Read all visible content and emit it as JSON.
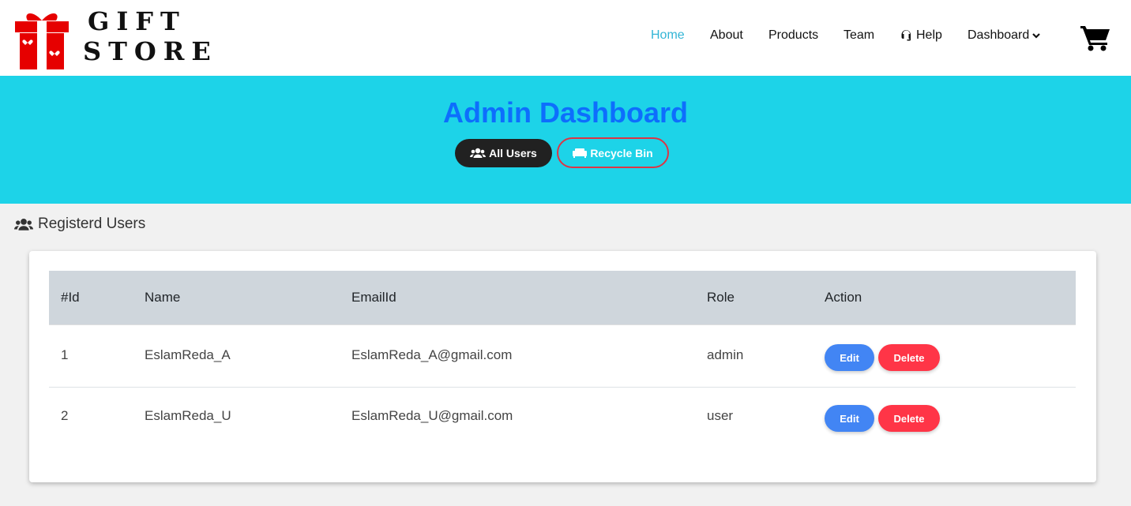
{
  "brand": {
    "line1": "GIFT",
    "line2": "STORE"
  },
  "nav": {
    "home": "Home",
    "about": "About",
    "products": "Products",
    "team": "Team",
    "help": "Help",
    "dashboard": "Dashboard"
  },
  "hero": {
    "title": "Admin Dashboard",
    "all_users": "All Users",
    "recycle_bin": "Recycle Bin"
  },
  "section": {
    "heading": "Registerd Users"
  },
  "table": {
    "headers": [
      "#Id",
      "Name",
      "EmailId",
      "Role",
      "Action"
    ],
    "rows": [
      {
        "id": "1",
        "name": "EslamReda_A",
        "email": "EslamReda_A@gmail.com",
        "role": "admin"
      },
      {
        "id": "2",
        "name": "EslamReda_U",
        "email": "EslamReda_U@gmail.com",
        "role": "user"
      }
    ],
    "edit_label": "Edit",
    "delete_label": "Delete"
  },
  "colors": {
    "hero_bg": "#1dd3e8",
    "title": "#0d6efd",
    "nav_active": "#33b5d6",
    "edit": "#4285f4",
    "delete": "#ff3547"
  },
  "icons": [
    "gift-logo-icon",
    "headset-icon",
    "chevron-down-icon",
    "cart-icon",
    "users-icon",
    "couch-icon"
  ]
}
